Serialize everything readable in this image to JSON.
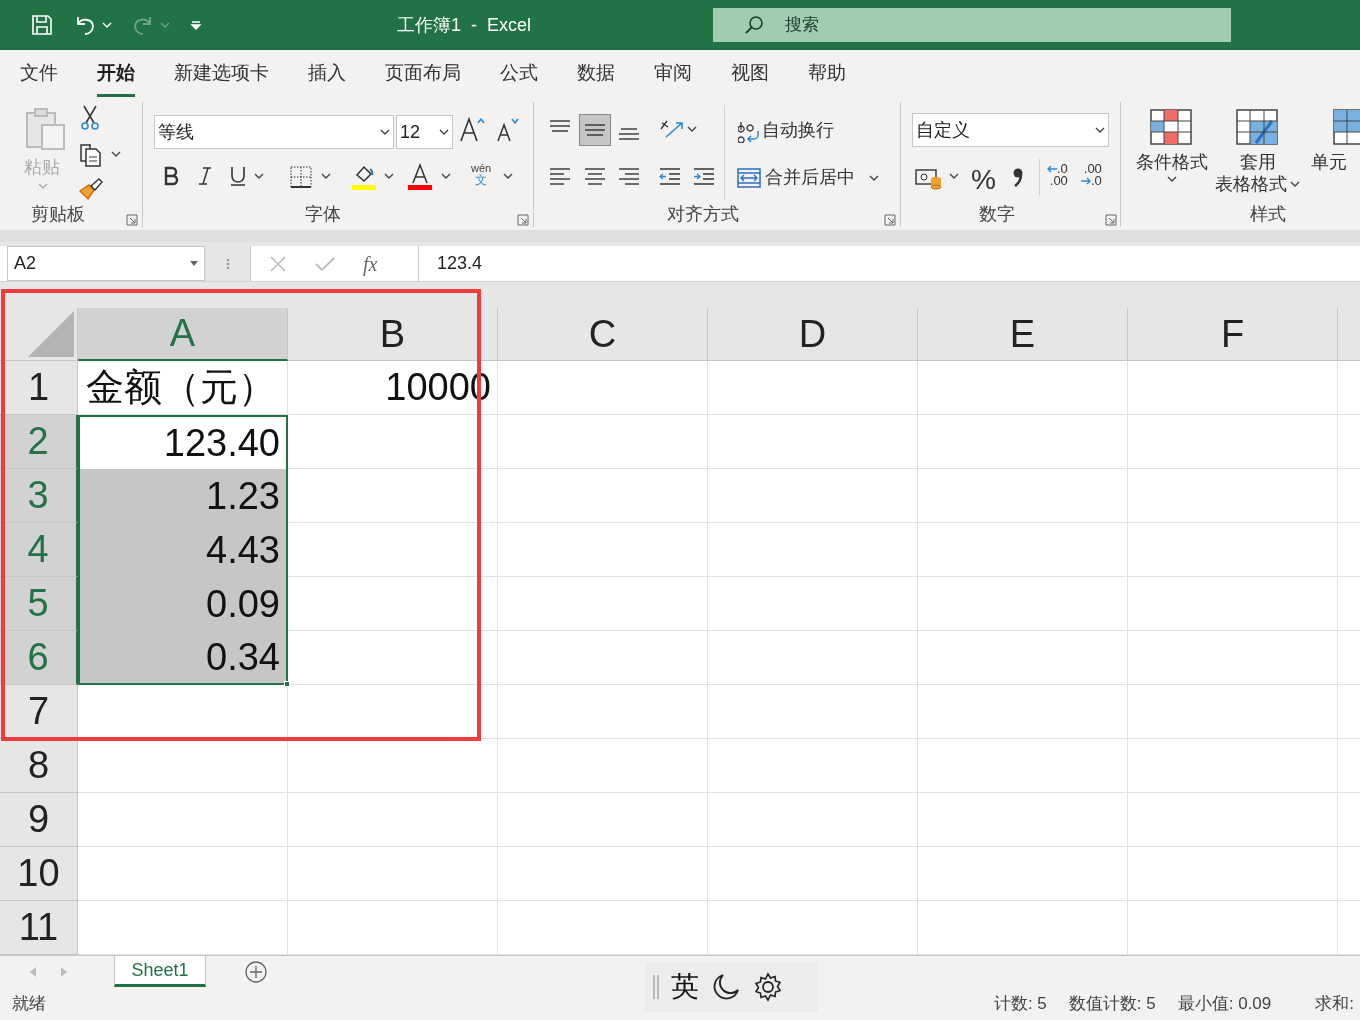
{
  "title_bar": {
    "title": "工作簿1  -  Excel",
    "search_placeholder": "搜索"
  },
  "menu_tabs": [
    {
      "label": "文件",
      "selected": false
    },
    {
      "label": "开始",
      "selected": true
    },
    {
      "label": "新建选项卡",
      "selected": false
    },
    {
      "label": "插入",
      "selected": false
    },
    {
      "label": "页面布局",
      "selected": false
    },
    {
      "label": "公式",
      "selected": false
    },
    {
      "label": "数据",
      "selected": false
    },
    {
      "label": "审阅",
      "selected": false
    },
    {
      "label": "视图",
      "selected": false
    },
    {
      "label": "帮助",
      "selected": false
    }
  ],
  "ribbon": {
    "clipboard": {
      "paste": "粘贴",
      "label": "剪贴板"
    },
    "font": {
      "font_name": "等线",
      "font_size": "12",
      "phonetic": "wén",
      "phonetic_char": "文",
      "label": "字体"
    },
    "alignment": {
      "wrap_text": "自动换行",
      "merge_center": "合并后居中",
      "label": "对齐方式",
      "middle_align_selected": true
    },
    "number": {
      "format": "自定义",
      "percent": "%",
      "increase_decimal": [
        ".0",
        ".00"
      ],
      "decrease_decimal": [
        ".00",
        ".0"
      ],
      "label": "数字"
    },
    "styles": {
      "conditional": "条件格式",
      "table_format": [
        "套用",
        "表格格式"
      ],
      "cell_styles": "单元",
      "label": "样式"
    }
  },
  "formula_bar": {
    "name_box": "A2",
    "fx": "fx",
    "value": "123.4"
  },
  "sheet": {
    "columns": [
      {
        "label": "A",
        "selected": true
      },
      {
        "label": "B",
        "selected": false
      },
      {
        "label": "C",
        "selected": false
      },
      {
        "label": "D",
        "selected": false
      },
      {
        "label": "E",
        "selected": false
      },
      {
        "label": "F",
        "selected": false
      }
    ],
    "rows": [
      {
        "header": "1",
        "selected": false,
        "cells": [
          {
            "text": "金额（元）",
            "kind": "text",
            "selected": false
          },
          {
            "text": "10000",
            "kind": "number",
            "selected": false
          }
        ]
      },
      {
        "header": "2",
        "selected": true,
        "cells": [
          {
            "text": "123.40",
            "kind": "number",
            "selected": true,
            "active": true
          }
        ]
      },
      {
        "header": "3",
        "selected": true,
        "cells": [
          {
            "text": "1.23",
            "kind": "number",
            "selected": true,
            "active": false
          }
        ]
      },
      {
        "header": "4",
        "selected": true,
        "cells": [
          {
            "text": "4.43",
            "kind": "number",
            "selected": true,
            "active": false
          }
        ]
      },
      {
        "header": "5",
        "selected": true,
        "cells": [
          {
            "text": "0.09",
            "kind": "number",
            "selected": true,
            "active": false
          }
        ]
      },
      {
        "header": "6",
        "selected": true,
        "cells": [
          {
            "text": "0.34",
            "kind": "number",
            "selected": true,
            "active": false
          }
        ]
      },
      {
        "header": "7",
        "selected": false,
        "cells": []
      },
      {
        "header": "8",
        "selected": false,
        "cells": []
      },
      {
        "header": "9",
        "selected": false,
        "cells": []
      },
      {
        "header": "10",
        "selected": false,
        "cells": []
      },
      {
        "header": "11",
        "selected": false,
        "cells": []
      }
    ]
  },
  "sheet_tabs": [
    {
      "label": "Sheet1",
      "selected": true
    }
  ],
  "ime_toolbar": {
    "mode": "英"
  },
  "status_bar": {
    "status": "就绪",
    "stats": [
      "计数: 5",
      "数值计数: 5",
      "最小值: 0.09",
      "求和:"
    ]
  }
}
